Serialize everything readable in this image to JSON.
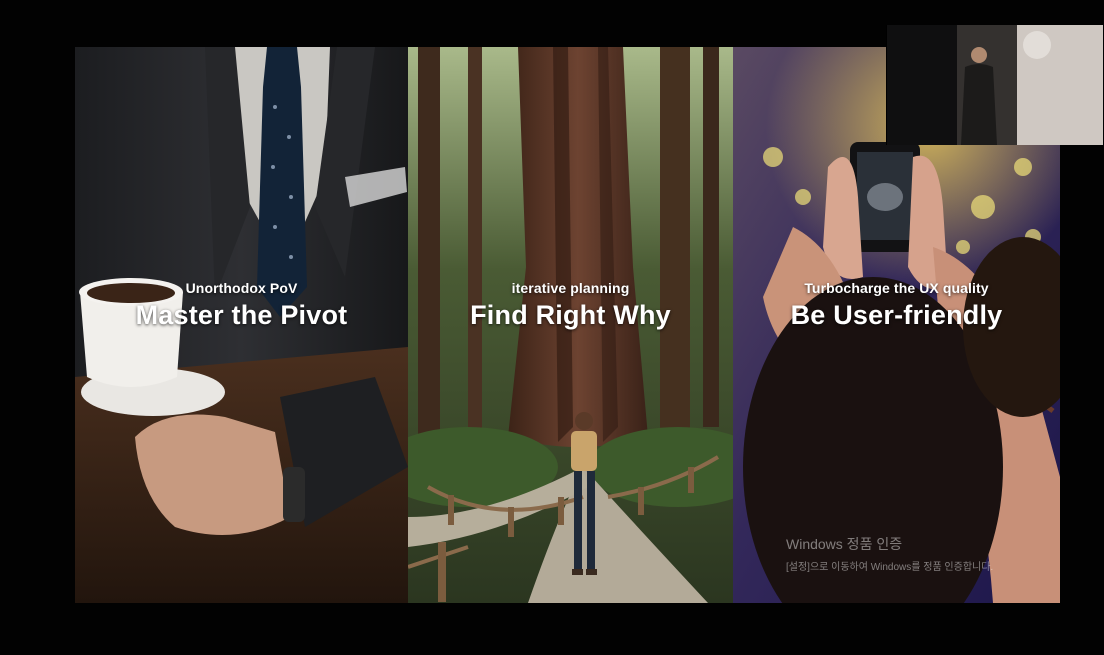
{
  "panels": [
    {
      "subtitle": "Unorthodox PoV",
      "title": "Master the Pivot"
    },
    {
      "subtitle": "iterative planning",
      "title": "Find Right Why"
    },
    {
      "subtitle": "Turbocharge the UX quality",
      "title": "Be User-friendly"
    }
  ],
  "watermark": {
    "line1": "Windows 정품 인증",
    "line2": "[설정]으로 이동하여 Windows를 정품 인증합니다."
  }
}
